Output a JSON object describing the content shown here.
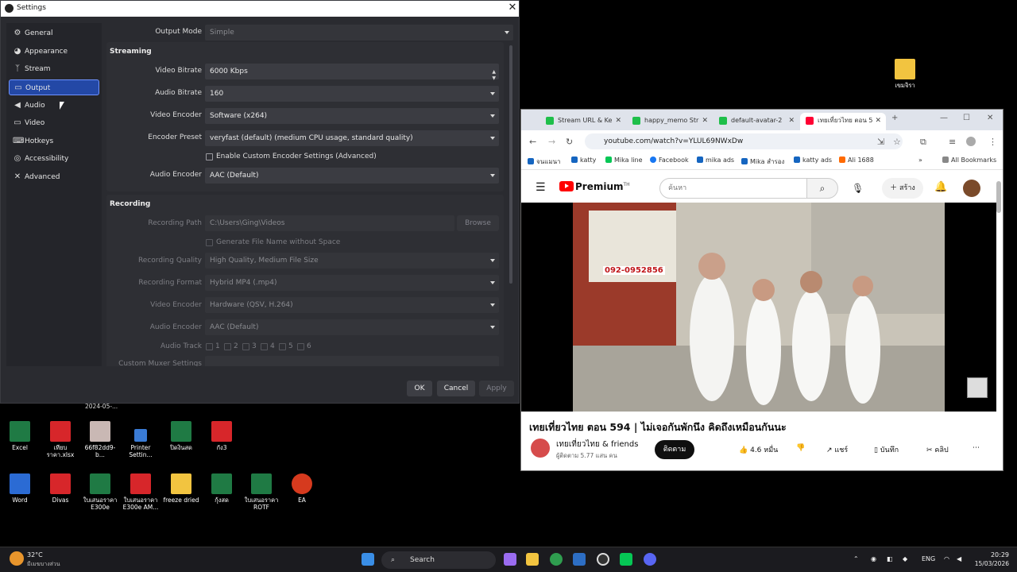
{
  "settings": {
    "title": "Settings",
    "nav": [
      {
        "label": "General",
        "icon": "gear-icon",
        "glyph": "⚙"
      },
      {
        "label": "Appearance",
        "icon": "palette-icon",
        "glyph": "◕"
      },
      {
        "label": "Stream",
        "icon": "antenna-icon",
        "glyph": "ᛉ"
      },
      {
        "label": "Output",
        "icon": "output-icon",
        "glyph": "▭"
      },
      {
        "label": "Audio",
        "icon": "speaker-icon",
        "glyph": "🔊"
      },
      {
        "label": "Video",
        "icon": "monitor-icon",
        "glyph": "▭"
      },
      {
        "label": "Hotkeys",
        "icon": "keyboard-icon",
        "glyph": "⌨"
      },
      {
        "label": "Accessibility",
        "icon": "accessibility-icon",
        "glyph": "◎"
      },
      {
        "label": "Advanced",
        "icon": "wrench-icon",
        "glyph": "✕"
      }
    ],
    "active_nav": "Output",
    "output_mode_label": "Output Mode",
    "output_mode_value": "Simple",
    "streaming": {
      "heading": "Streaming",
      "video_bitrate_label": "Video Bitrate",
      "video_bitrate_value": "6000 Kbps",
      "audio_bitrate_label": "Audio Bitrate",
      "audio_bitrate_value": "160",
      "video_encoder_label": "Video Encoder",
      "video_encoder_value": "Software (x264)",
      "encoder_preset_label": "Encoder Preset",
      "encoder_preset_value": "veryfast (default) (medium CPU usage, standard quality)",
      "custom_encoder_label": "Enable Custom Encoder Settings (Advanced)",
      "audio_encoder_label": "Audio Encoder",
      "audio_encoder_value": "AAC (Default)"
    },
    "recording": {
      "heading": "Recording",
      "path_label": "Recording Path",
      "path_value": "C:\\Users\\Ging\\Videos",
      "browse_label": "Browse",
      "filename_label": "Generate File Name without Space",
      "quality_label": "Recording Quality",
      "quality_value": "High Quality, Medium File Size",
      "format_label": "Recording Format",
      "format_value": "Hybrid MP4 (.mp4)",
      "video_encoder_label": "Video Encoder",
      "video_encoder_value": "Hardware (QSV, H.264)",
      "audio_encoder_label": "Audio Encoder",
      "audio_encoder_value": "AAC (Default)",
      "audio_track_label": "Audio Track",
      "tracks": [
        "1",
        "2",
        "3",
        "4",
        "5",
        "6"
      ],
      "muxer_label": "Custom Muxer Settings"
    },
    "ok_label": "OK",
    "cancel_label": "Cancel",
    "apply_label": "Apply"
  },
  "chrome": {
    "tabs": [
      {
        "title": "Stream URL & Ke",
        "favicon_color": "#1fbf4a"
      },
      {
        "title": "happy_memo Str",
        "favicon_color": "#1fbf4a"
      },
      {
        "title": "default-avatar-2",
        "favicon_color": "#1fbf4a"
      },
      {
        "title": "เทยเที่ยวไทย ตอน 5",
        "favicon_color": "#ff0033"
      }
    ],
    "url": "youtube.com/watch?v=YLUL69NWxDw",
    "bookmarks": [
      {
        "label": "จนแมนา",
        "color": "#1565c0"
      },
      {
        "label": "katty",
        "color": "#1565c0"
      },
      {
        "label": "Mika line",
        "color": "#06c755"
      },
      {
        "label": "Facebook",
        "color": "#1877f2"
      },
      {
        "label": "mika ads",
        "color": "#1565c0"
      },
      {
        "label": "Mika สำรอง",
        "color": "#1565c0"
      },
      {
        "label": "katty ads",
        "color": "#1565c0"
      },
      {
        "label": "Ali 1688",
        "color": "#ff6a00"
      }
    ],
    "all_bookmarks_label": "All Bookmarks",
    "yt_brand": "Premium",
    "yt_region": "TH",
    "search_placeholder": "ค้นหา",
    "create_label": "สร้าง",
    "video_title": "เทยเที่ยวไทย ตอน 594 | ไม่เจอกันพักนึง คิดถึงเหมือนกันนะ",
    "channel_name": "เทยเที่ยวไทย & friends",
    "subscribers": "ผู้ติดตาม 5.77 แสน คน",
    "subscribe_label": "ติดตาม",
    "likes": "4.6 หมื่น",
    "share_label": "แชร์",
    "save_label": "บันทึก",
    "clip_label": "คลิป",
    "overlay_text": "092-0952856"
  },
  "desktop": {
    "top_right_folder": "เขมจิรา",
    "date_label": "2024-05-...",
    "icons_row1": [
      {
        "label": "Excel",
        "kind": "xls"
      },
      {
        "label": "เทียบราคา.xlsx",
        "kind": "pdf"
      },
      {
        "label": "66f82dd9-b...",
        "kind": "img"
      },
      {
        "label": "Printer Settin...",
        "kind": "shield"
      },
      {
        "label": "ปิดงินสด",
        "kind": "xls"
      },
      {
        "label": "กัง3",
        "kind": "pdf"
      }
    ],
    "icons_row2": [
      {
        "label": "Word",
        "kind": "word"
      },
      {
        "label": "Divas",
        "kind": "pdf"
      },
      {
        "label": "ใบเสนอราคา E300e",
        "kind": "xls"
      },
      {
        "label": "ใบเสนอราคา E300e AM...",
        "kind": "pdf"
      },
      {
        "label": "freeze dried",
        "kind": "fold"
      },
      {
        "label": "กุ้งสด",
        "kind": "xls"
      },
      {
        "label": "ใบเสนอราคา ROTF",
        "kind": "xls"
      },
      {
        "label": "EA",
        "kind": "ea"
      }
    ]
  },
  "taskbar": {
    "weather_temp": "32°C",
    "weather_desc": "มีเมฆบางส่วน",
    "search_placeholder": "Search",
    "lang": "ENG",
    "time": "20:29",
    "date": "15/03/2026"
  }
}
